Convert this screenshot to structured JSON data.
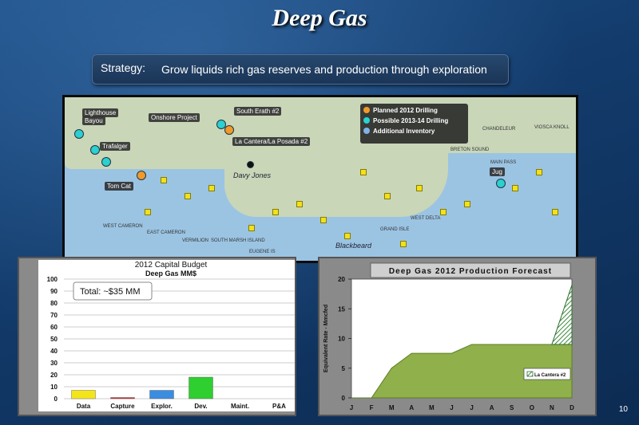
{
  "slide": {
    "title": "Deep Gas",
    "strategy_label": "Strategy:",
    "strategy_text": "Grow liquids rich gas reserves and production through exploration",
    "page_number": "10"
  },
  "map": {
    "labels": [
      "Lighthouse",
      "Bayou",
      "Onshore Project",
      "South Erath #2",
      "La Cantera/La Posada #2",
      "Trafalger",
      "Tom Cat",
      "Davy Jones",
      "Blackbeard",
      "Jug"
    ],
    "legend": [
      "Planned 2012 Drilling",
      "Possible 2013-14 Drilling",
      "Additional Inventory"
    ],
    "region_labels": [
      "WEST CAMERON",
      "EAST CAMERON",
      "VERMILION",
      "SOUTH MARSH ISLAND",
      "EUGENE IS",
      "GRAND ISLE",
      "WEST DELTA",
      "CHANDELEUR",
      "VIOSCA KNOLL",
      "BRETON SOUND",
      "MAIN PASS"
    ]
  },
  "chart_data": [
    {
      "type": "bar",
      "title": "2012 Capital Budget",
      "subtitle": "Deep Gas MM$",
      "annotation": "Total: ~$35 MM",
      "categories": [
        "Data",
        "Capture",
        "Explor.",
        "Dev.",
        "Maint.",
        "P&A"
      ],
      "values": [
        7,
        1,
        7,
        18,
        0,
        0
      ],
      "colors": [
        "#f4e51b",
        "#d03030",
        "#3b8de0",
        "#2fcf2f",
        "#888888",
        "#888888"
      ],
      "yticks": [
        "100",
        "90",
        "80",
        "70",
        "60",
        "50",
        "40",
        "30",
        "20",
        "10",
        "0"
      ],
      "ylim": [
        0,
        100
      ],
      "grid": true
    },
    {
      "type": "area",
      "title": "Deep Gas 2012 Production Forecast",
      "ylabel": "Equivalent Rate - Mmcfed",
      "categories": [
        "J",
        "F",
        "M",
        "A",
        "M",
        "J",
        "J",
        "A",
        "S",
        "O",
        "N",
        "D"
      ],
      "series": [
        {
          "name": "",
          "values": [
            0,
            0,
            5,
            7.5,
            7.5,
            7.5,
            9,
            9,
            9,
            9,
            9,
            9
          ]
        },
        {
          "name": "La Cantera #2",
          "values": [
            0,
            0,
            0,
            0,
            0,
            0,
            0,
            0,
            0,
            0,
            0,
            10
          ]
        }
      ],
      "yticks": [
        "0",
        "5",
        "10",
        "15",
        "20"
      ],
      "ylim": [
        0,
        20
      ],
      "legend": "inside-right"
    }
  ]
}
